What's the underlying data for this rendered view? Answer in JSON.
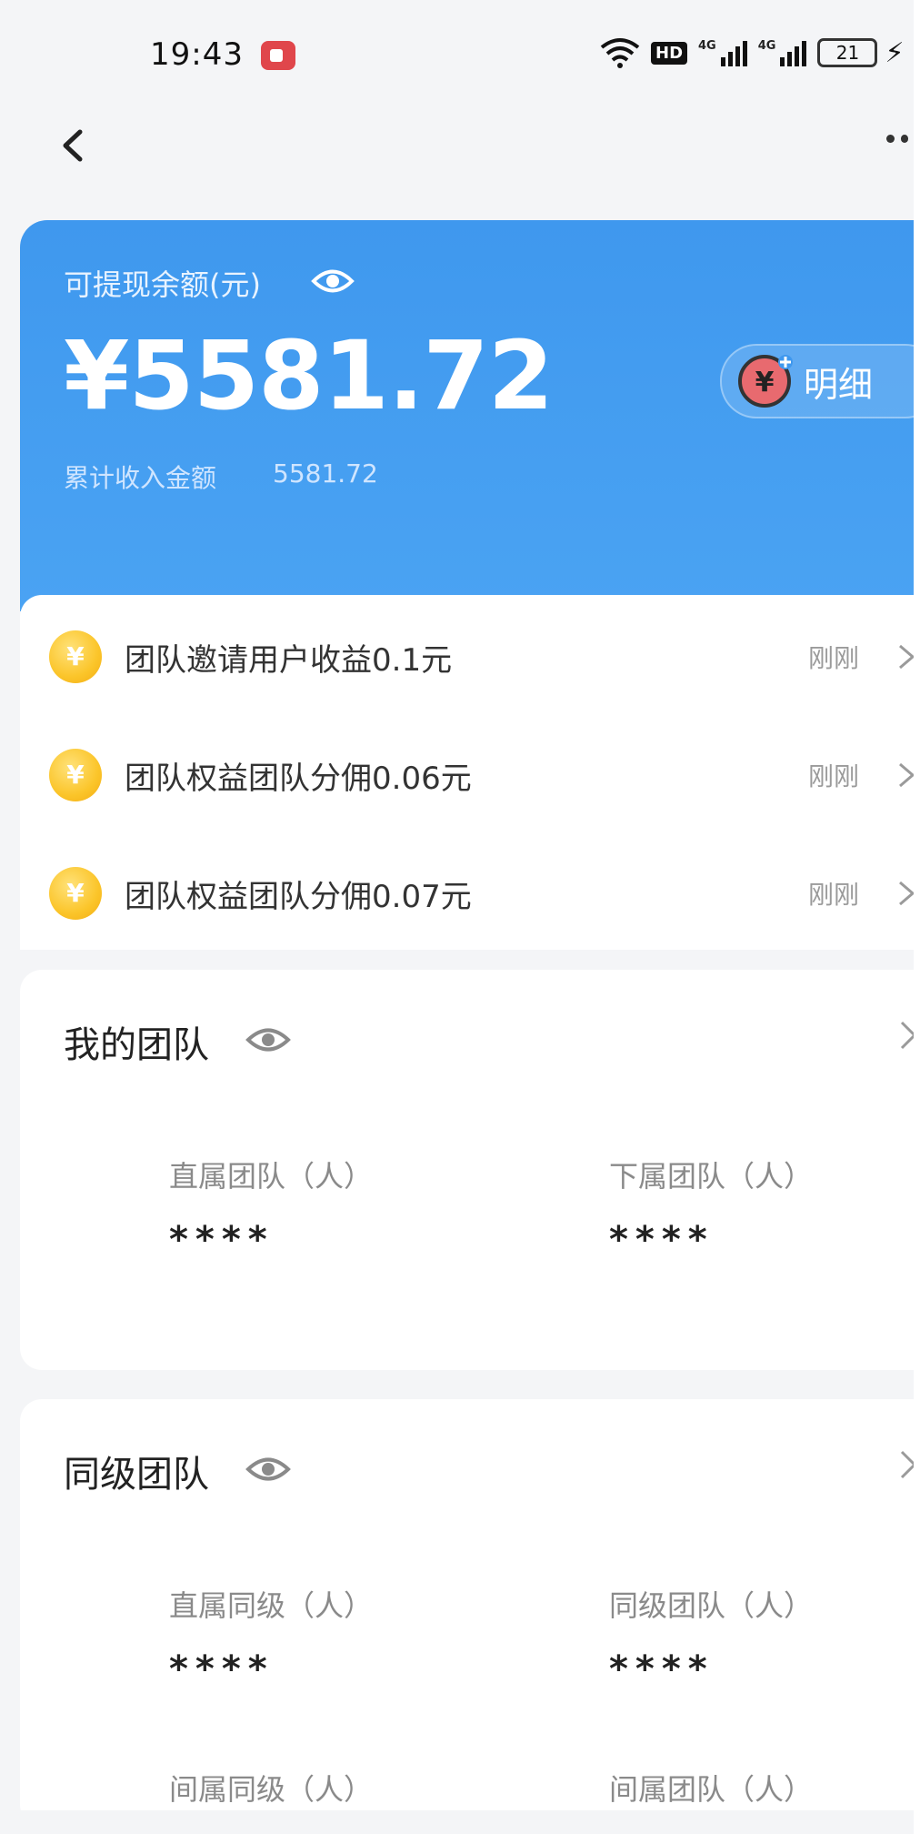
{
  "status_bar": {
    "time": "19:43",
    "hd_label": "HD",
    "network_label_1": "4G",
    "network_label_2": "4G",
    "battery_level": "21"
  },
  "balance_card": {
    "title": "可提现余额(元)",
    "amount": "¥5581.72",
    "cumulative_label": "累计收入金额",
    "cumulative_value": "5581.72",
    "detail_label": "明细",
    "detail_icon_glyph": "¥"
  },
  "notifications": [
    {
      "text": "团队邀请用户收益0.1元",
      "time": "刚刚",
      "coin_glyph": "¥"
    },
    {
      "text": "团队权益团队分佣0.06元",
      "time": "刚刚",
      "coin_glyph": "¥"
    },
    {
      "text": "团队权益团队分佣0.07元",
      "time": "刚刚",
      "coin_glyph": "¥"
    }
  ],
  "my_team": {
    "title": "我的团队",
    "stats": [
      {
        "label": "直属团队（人）",
        "value": "****"
      },
      {
        "label": "下属团队（人）",
        "value": "****"
      }
    ]
  },
  "peer_team": {
    "title": "同级团队",
    "stats": [
      {
        "label": "直属同级（人）",
        "value": "****"
      },
      {
        "label": "同级团队（人）",
        "value": "****"
      },
      {
        "label": "间属同级（人）",
        "value": ""
      },
      {
        "label": "间属团队（人）",
        "value": ""
      }
    ]
  },
  "colors": {
    "card_blue": "#4aa3f3",
    "coin_gold": "#fbc52a",
    "background": "#f4f5f7"
  }
}
